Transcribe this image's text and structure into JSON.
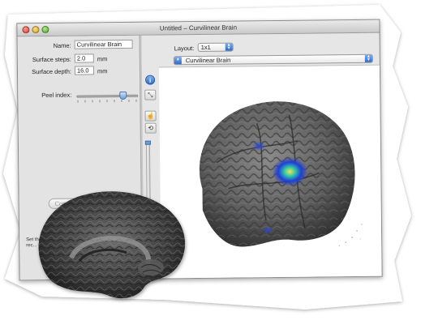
{
  "window": {
    "title": "Untitled – Curvilinear Brain"
  },
  "left_panel": {
    "name_label": "Name:",
    "name_value": "Curvilinear Brain",
    "steps_label": "Surface steps:",
    "steps_value": "2.0",
    "steps_unit": "mm",
    "depth_label": "Surface depth:",
    "depth_value": "16.0",
    "depth_unit": "mm",
    "peel_label": "Peel index:",
    "peel_level": 0.75,
    "compute_button": "Compute Curvilinear",
    "info_text": "Set the ... and ... \"C... rec... d..."
  },
  "viewer": {
    "layout_label": "Layout:",
    "layout_value": "1x1",
    "layer_value": "Curvilinear Brain"
  },
  "icons": {
    "info": "info-icon",
    "resize": "resize-icon",
    "hand": "hand-icon",
    "rotate": "rotate-icon"
  },
  "colors": {
    "activation_core": "#f2e64a",
    "activation_mid": "#35c9a6",
    "activation_outer": "#1f3fd8",
    "slider_accent": "#6b9fe2"
  }
}
